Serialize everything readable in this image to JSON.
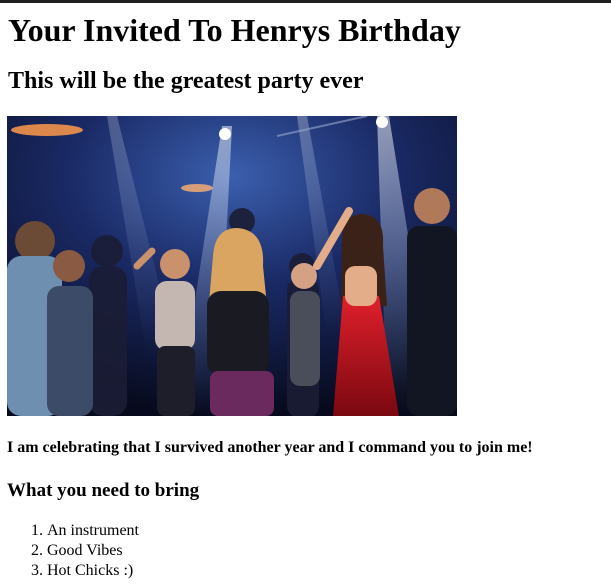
{
  "page": {
    "title": "Your Invited To Henrys Birthday",
    "subtitle": "This will be the greatest party ever",
    "message": "I am celebrating that I survived another year and I command you to join me!",
    "bring_heading": "What you need to bring",
    "bring_items": [
      "An instrument",
      "Good Vibes",
      "Hot Chicks :)"
    ]
  },
  "image": {
    "subject": "crowd dancing at a party under stage lights"
  },
  "colors": {
    "text": "#000000",
    "background": "#ffffff",
    "top_bar": "#1f1f1f",
    "dress_red": "#b0101a",
    "light_blue": "#7fb0ff"
  }
}
